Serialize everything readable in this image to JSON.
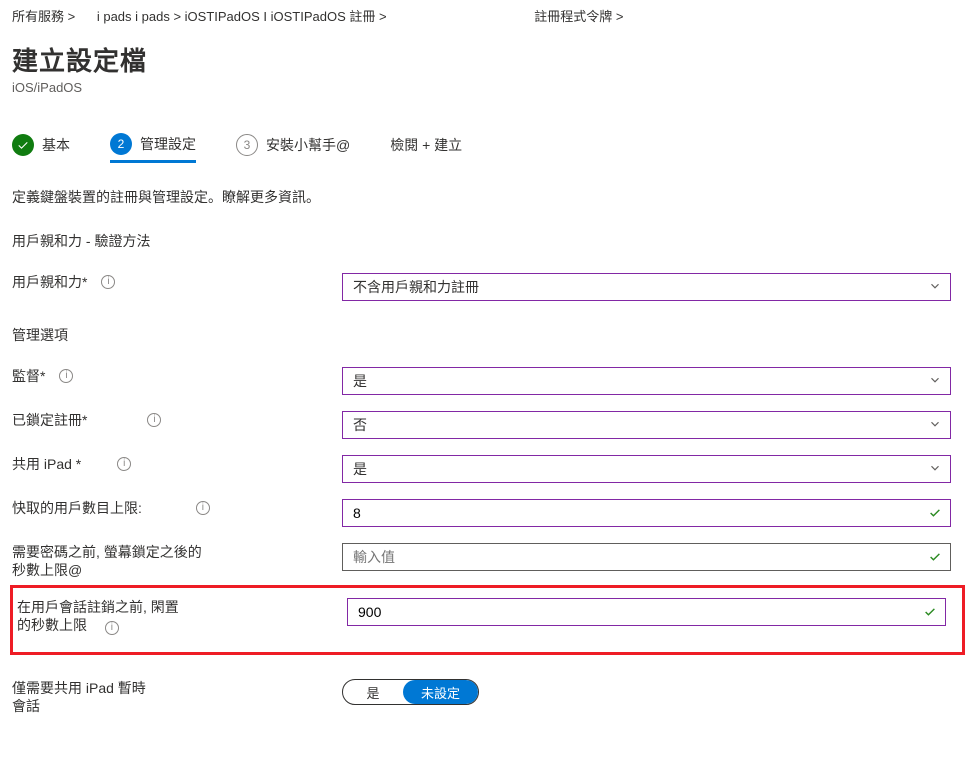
{
  "breadcrumbs": {
    "b1": "所有服務 >",
    "b2": "i pads i pads > iOSTIPadOS I iOSTIPadOS 註冊 >",
    "b3": "註冊程式令牌 >"
  },
  "header": {
    "title": "建立設定檔",
    "subtitle": "iOS/iPadOS"
  },
  "tabs": {
    "t1": "基本",
    "t2": "管理設定",
    "t3_num": "3",
    "t3": "安裝小幫手@",
    "t4": "檢閱 + 建立"
  },
  "desc": "定義鍵盤裝置的註冊與管理設定。瞭解更多資訊。",
  "sections": {
    "auth": "用戶親和力 - 驗證方法",
    "mgmt": "管理選項"
  },
  "fields": {
    "affinity": {
      "label": "用戶親和力*",
      "value": "不含用戶親和力註冊"
    },
    "supervised": {
      "label": "監督*",
      "value": "是"
    },
    "locked": {
      "label": "已鎖定註冊*",
      "value": "否"
    },
    "shared": {
      "label": "共用 iPad *",
      "value": "是"
    },
    "maxcached": {
      "label": "快取的用戶數目上限:",
      "value": "8"
    },
    "lockscreen": {
      "label": "需要密碼之前, 螢幕鎖定之後的秒數上限@",
      "placeholder": "輸入值"
    },
    "idle": {
      "label_line1": "在用戶會話註銷之前, 閑置",
      "label_line2": "的秒數上限",
      "value": "900"
    },
    "temponly": {
      "label_line1": "僅需要共用 iPad 暫時",
      "label_line2": "會話",
      "opt_yes": "是",
      "opt_unset": "未設定"
    }
  }
}
